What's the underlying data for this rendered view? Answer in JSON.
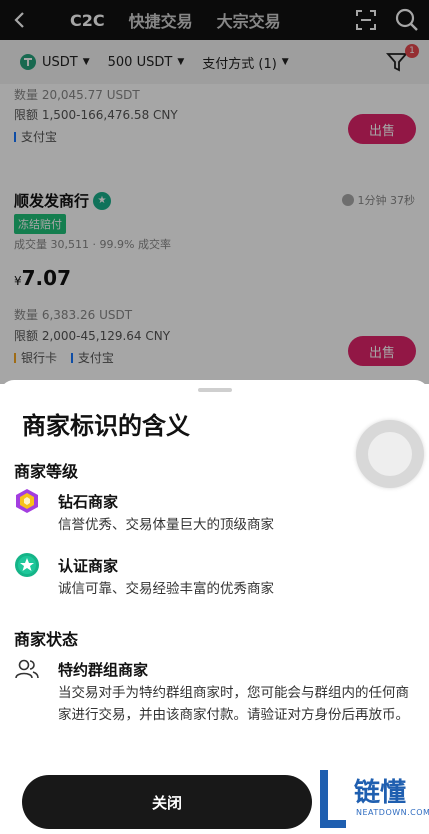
{
  "header": {
    "tabs": [
      {
        "label": "C2C",
        "active": true
      },
      {
        "label": "快捷交易",
        "active": false
      },
      {
        "label": "大宗交易",
        "active": false
      }
    ]
  },
  "filters": {
    "coin": "USDT",
    "amount": "500 USDT",
    "payment": "支付方式 (1)",
    "badge_count": "1"
  },
  "listing_prev": {
    "quantity_partial": "数量 20,045.77 USDT",
    "limit": "限额 1,500-166,476.58 CNY",
    "payment": "支付宝",
    "sell_label": "出售"
  },
  "listing": {
    "merchant": "顺发发商行",
    "time": "1分钟 37秒",
    "badge": "冻结赔付",
    "volume": "成交量 30,511",
    "rate": "99.9% 成交率",
    "currency_symbol": "¥",
    "price": "7.07",
    "quantity": "数量 6,383.26 USDT",
    "limit": "限额 2,000-45,129.64 CNY",
    "pay_methods": [
      "银行卡",
      "支付宝"
    ],
    "sell_label": "出售"
  },
  "sheet": {
    "title": "商家标识的含义",
    "level_section": "商家等级",
    "diamond": {
      "title": "钻石商家",
      "desc": "信誉优秀、交易体量巨大的顶级商家"
    },
    "certified": {
      "title": "认证商家",
      "desc": "诚信可靠、交易经验丰富的优秀商家"
    },
    "status_section": "商家状态",
    "group": {
      "title": "特约群组商家",
      "desc": "当交易对手为特约群组商家时，您可能会与群组内的任何商家进行交易，并由该商家付款。请验证对方身份后再放币。"
    },
    "close_label": "关闭"
  },
  "watermark": {
    "text": "链懂",
    "sub": "NEATDOWN.COM"
  },
  "colors": {
    "accent": "#e0246a",
    "badge_green": "#20c27a",
    "header_bg": "#111111"
  }
}
